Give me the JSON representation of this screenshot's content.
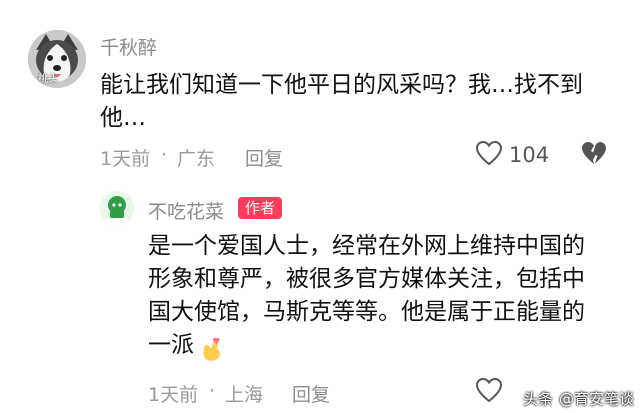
{
  "comments": [
    {
      "username": "千秋醉",
      "avatar_label": "桃头",
      "text_line1": "能让我们知道一下他平日的风采吗？我…找不到",
      "text_line2": "他…",
      "time": "1天前",
      "separator": "·",
      "location": "广东",
      "reply_label": "回复",
      "like_count": "104"
    },
    {
      "username": "不吃花菜",
      "author_badge": "作者",
      "text_line1": "是一个爱国人士，经常在外网上维持中国的",
      "text_line2": "形象和尊严，被很多官方媒体关注，包括中",
      "text_line3": "国大使馆，马斯克等等。他是属于正能量的",
      "text_line4": "一派",
      "emoji": "🫰",
      "time": "1天前",
      "separator": "·",
      "location": "上海",
      "reply_label": "回复"
    }
  ],
  "watermark": {
    "text1": "头条",
    "text2": "@育安笔谈"
  },
  "colors": {
    "badge": "#ff3b5c",
    "meta": "#9a9a9a",
    "text": "#111111"
  }
}
